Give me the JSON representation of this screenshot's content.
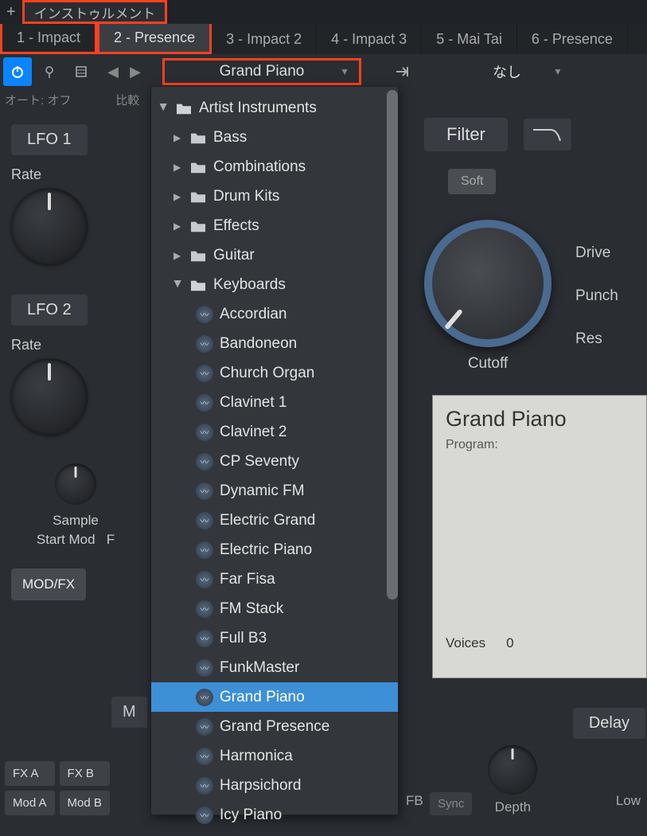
{
  "top": {
    "menu_label": "インストゥルメント"
  },
  "tabs": [
    {
      "label": "1 - Impact"
    },
    {
      "label": "2 - Presence"
    },
    {
      "label": "3 - Impact 2"
    },
    {
      "label": "4 - Impact 3"
    },
    {
      "label": "5 - Mai Tai"
    },
    {
      "label": "6 - Presence"
    }
  ],
  "toolbar": {
    "preset": "Grand Piano",
    "midi_label": "なし",
    "auto_label": "オート: オフ",
    "compare_label": "比較"
  },
  "lfo1": {
    "title": "LFO 1",
    "rate": "Rate"
  },
  "lfo2": {
    "title": "LFO 2",
    "rate": "Rate"
  },
  "sample": {
    "line1": "Sample",
    "line2": "Start Mod",
    "extra": "F"
  },
  "modfx_btn": "MOD/FX",
  "m_hdr": "M",
  "fx_buttons": {
    "a": "FX A",
    "b": "FX B",
    "mod_a": "Mod A",
    "mod_b": "Mod B"
  },
  "filter": {
    "title": "Filter",
    "soft": "Soft",
    "drive": "Drive",
    "punch": "Punch",
    "res": "Res",
    "cutoff": "Cutoff"
  },
  "display": {
    "title": "Grand Piano",
    "program_label": "Program:",
    "voices_label": "Voices",
    "voices_value": "0"
  },
  "delay": {
    "title": "Delay",
    "sync": "Sync",
    "depth": "Depth",
    "fb": "FB",
    "low": "Low"
  },
  "tree": {
    "root": "Artist Instruments",
    "folders": [
      "Bass",
      "Combinations",
      "Drum Kits",
      "Effects",
      "Guitar",
      "Keyboards"
    ],
    "keyboard_presets": [
      "Accordian",
      "Bandoneon",
      "Church Organ",
      "Clavinet 1",
      "Clavinet 2",
      "CP Seventy",
      "Dynamic FM",
      "Electric Grand",
      "Electric Piano",
      "Far Fisa",
      "FM Stack",
      "Full B3",
      "FunkMaster",
      "Grand Piano",
      "Grand Presence",
      "Harmonica",
      "Harpsichord",
      "Icy Piano"
    ],
    "selected": "Grand Piano"
  }
}
